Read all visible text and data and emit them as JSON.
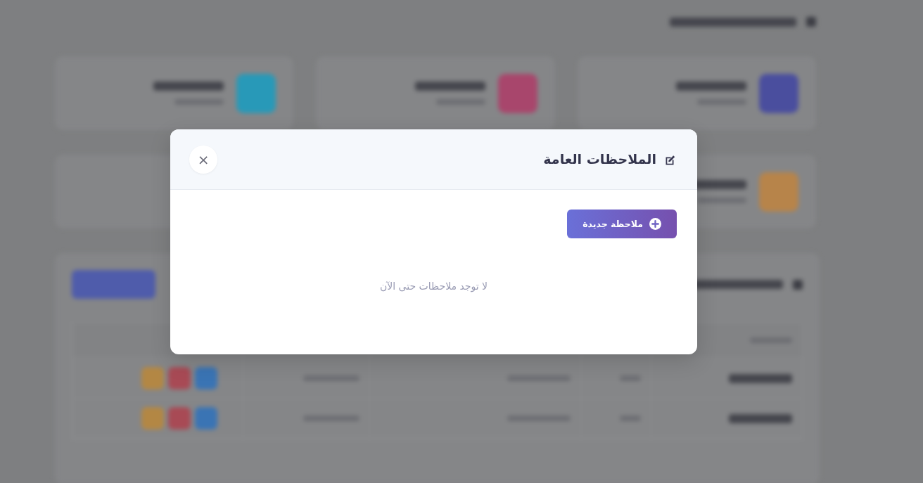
{
  "modal": {
    "title": "الملاحظات العامة",
    "close_label": "×",
    "new_note_button": "ملاحظة جديدة",
    "empty_message": "لا توجد ملاحظات حتى الآن"
  }
}
